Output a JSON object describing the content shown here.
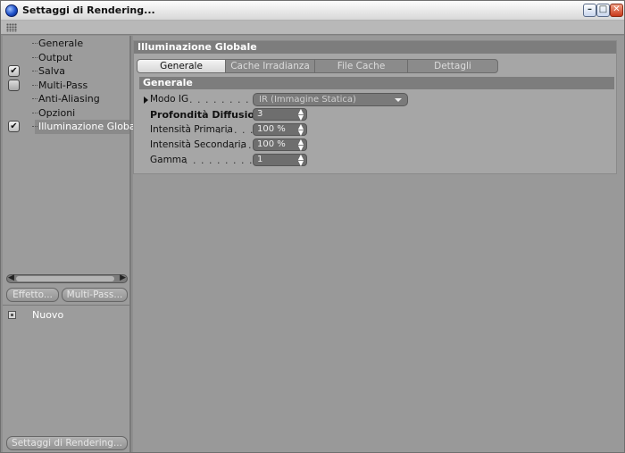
{
  "window": {
    "title": "Settaggi di Rendering...",
    "controls": {
      "minimize": "–",
      "maximize": "□",
      "close": "✕"
    }
  },
  "sidebar": {
    "items": [
      {
        "label": "Generale",
        "check": ""
      },
      {
        "label": "Output",
        "check": ""
      },
      {
        "label": "Salva",
        "check": "✔"
      },
      {
        "label": "Multi-Pass",
        "check": ""
      },
      {
        "label": "Anti-Aliasing",
        "check": ""
      },
      {
        "label": "Opzioni",
        "check": ""
      },
      {
        "label": "Illuminazione Globale",
        "check": "✔"
      }
    ],
    "buttons": {
      "effetto": "Effetto...",
      "multipass": "Multi-Pass..."
    },
    "preset": {
      "label": "Nuovo"
    },
    "settings_button": "Settaggi di Rendering..."
  },
  "main": {
    "section_title": "Illuminazione Globale",
    "tabs": [
      {
        "label": "Generale",
        "active": true
      },
      {
        "label": "Cache Irradianza",
        "active": false
      },
      {
        "label": "File Cache Irradianza",
        "active": false
      },
      {
        "label": "Dettagli",
        "active": false
      }
    ],
    "group_title": "Generale",
    "fields": {
      "modo_ig": {
        "label": "Modo IG",
        "dots": ". . . . . . . . . . . . .",
        "value": "IR (Immagine Statica)"
      },
      "profondita": {
        "label": "Profondità Diffusione",
        "value": "3"
      },
      "intensita_primaria": {
        "label": "Intensità Primaria",
        "dots": ". . . . . .",
        "value": "100 %"
      },
      "intensita_secondaria": {
        "label": "Intensità Secondaria",
        "dots": ". . .",
        "value": "100 %"
      },
      "gamma": {
        "label": "Gamma",
        "dots": ". . . . . . . . . . . . . . .",
        "value": "1"
      }
    },
    "spinner_arrows": "▲▼"
  }
}
